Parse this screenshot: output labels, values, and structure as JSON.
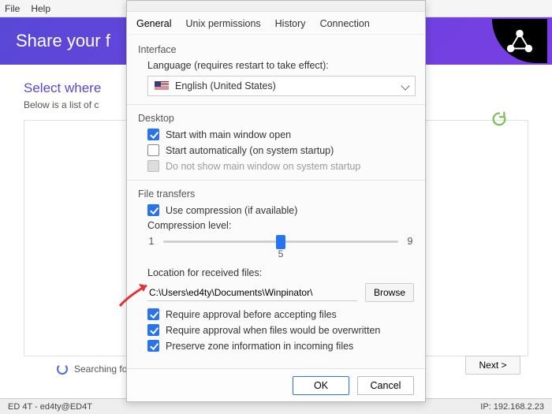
{
  "menubar": {
    "file": "File",
    "help": "Help"
  },
  "banner": {
    "text": "Share your f"
  },
  "main": {
    "select_title": "Select where",
    "select_sub": "Below is a list of c",
    "searching": "Searching fo",
    "next": "Next >"
  },
  "statusbar": {
    "left": "ED 4T - ed4ty@ED4T",
    "right": "IP: 192.168.2.23"
  },
  "dialog": {
    "tabs": {
      "general": "General",
      "unix": "Unix permissions",
      "history": "History",
      "connection": "Connection"
    },
    "interface": {
      "title": "Interface",
      "lang_label": "Language (requires restart to take effect):",
      "lang_value": "English (United States)"
    },
    "desktop": {
      "title": "Desktop",
      "start_main": "Start with main window open",
      "start_auto": "Start automatically (on system startup)",
      "no_show": "Do not show main window on system startup"
    },
    "transfers": {
      "title": "File transfers",
      "compress": "Use compression (if available)",
      "level_label": "Compression level:",
      "min": "1",
      "max": "9",
      "mid": "5",
      "location_label": "Location for received files:",
      "location_value": "C:\\Users\\ed4ty\\Documents\\Winpinator\\",
      "browse": "Browse",
      "approve": "Require approval before accepting files",
      "overwrite": "Require approval when files would be overwritten",
      "zone": "Preserve zone information in incoming files"
    },
    "buttons": {
      "ok": "OK",
      "cancel": "Cancel"
    }
  }
}
